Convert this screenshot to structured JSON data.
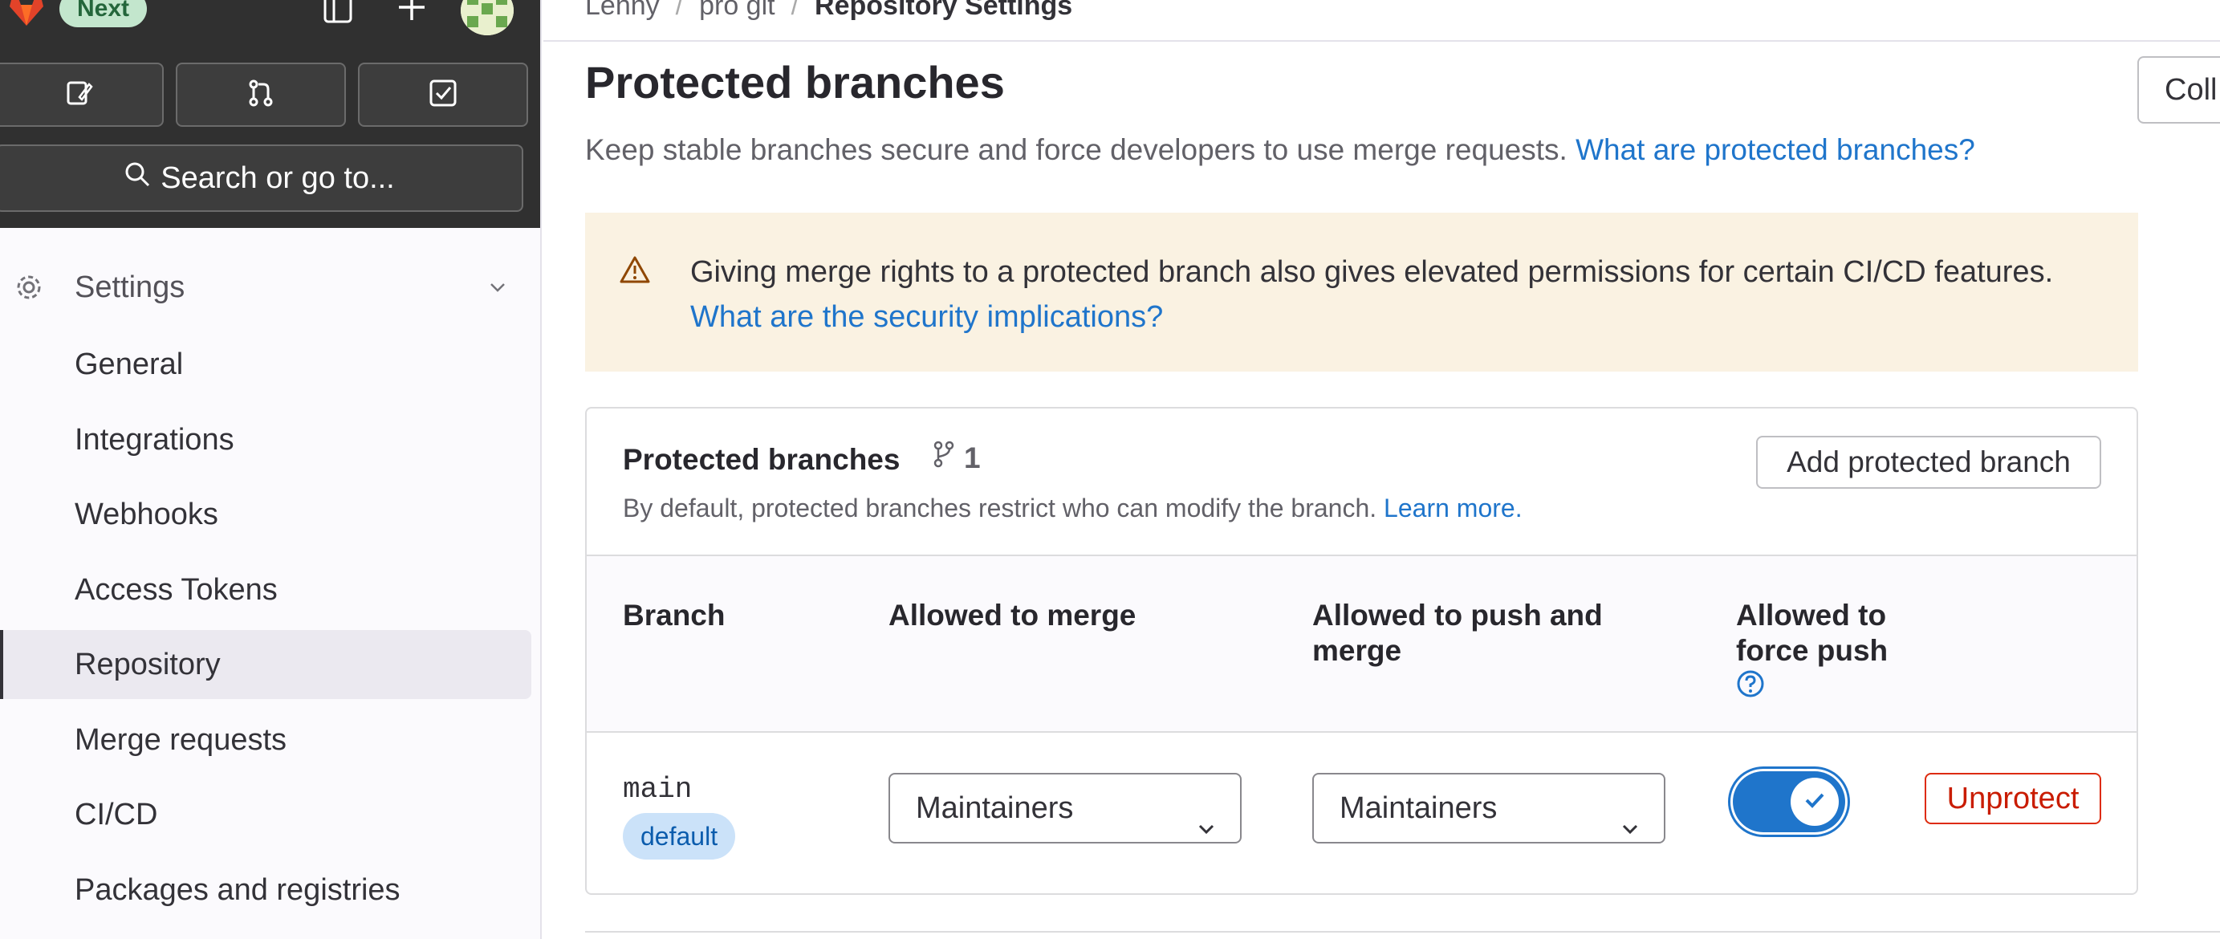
{
  "sidebar": {
    "next_badge": "Next",
    "search": {
      "label": "Search or go to..."
    },
    "section": {
      "label": "Settings"
    },
    "items": [
      {
        "label": "General"
      },
      {
        "label": "Integrations"
      },
      {
        "label": "Webhooks"
      },
      {
        "label": "Access Tokens"
      },
      {
        "label": "Repository",
        "active": true
      },
      {
        "label": "Merge requests"
      },
      {
        "label": "CI/CD"
      },
      {
        "label": "Packages and registries"
      }
    ]
  },
  "breadcrumb": {
    "items": [
      "Lenny",
      "pro git",
      "Repository Settings"
    ]
  },
  "header": {
    "title": "Protected branches",
    "collapse_label": "Coll",
    "description": "Keep stable branches secure and force developers to use merge requests.",
    "help_link": "What are protected branches?"
  },
  "alert": {
    "text": "Giving merge rights to a protected branch also gives elevated permissions for certain CI/CD features.",
    "link": "What are the security implications?"
  },
  "card": {
    "title": "Protected branches",
    "count": "1",
    "description": "By default, protected branches restrict who can modify the branch.",
    "learn_more": "Learn more.",
    "add_button": "Add protected branch",
    "columns": {
      "branch": "Branch",
      "merge": "Allowed to merge",
      "push": "Allowed to push and merge",
      "force": "Allowed to force push"
    },
    "rows": [
      {
        "branch": "main",
        "badge": "default",
        "merge": "Maintainers",
        "push": "Maintainers",
        "force_push": true,
        "action": "Unprotect"
      }
    ]
  },
  "colors": {
    "accent": "#1f75cb",
    "danger": "#dd2b0e",
    "sidebar_dark": "#303030",
    "alert_bg": "#faf2e2"
  }
}
